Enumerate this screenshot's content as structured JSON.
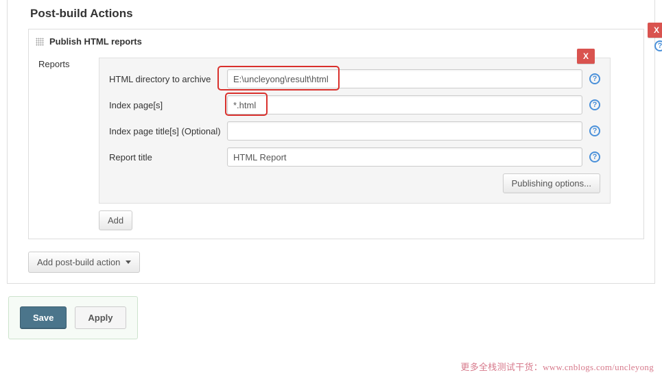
{
  "section_title": "Post-build Actions",
  "publish_block": {
    "title": "Publish HTML reports",
    "reports_label": "Reports",
    "delete_label": "X",
    "help_label": "?",
    "fields": {
      "html_dir": {
        "label": "HTML directory to archive",
        "value": "E:\\uncleyong\\result\\html"
      },
      "index_pages": {
        "label": "Index page[s]",
        "value": "*.html"
      },
      "index_titles": {
        "label": "Index page title[s] (Optional)",
        "value": ""
      },
      "report_title": {
        "label": "Report title",
        "value": "HTML Report"
      }
    },
    "publishing_options": "Publishing options...",
    "add_label": "Add"
  },
  "add_post_build_action": "Add post-build action",
  "footer": {
    "save": "Save",
    "apply": "Apply"
  },
  "watermark": "更多全栈测试干货：www.cnblogs.com/uncleyong"
}
